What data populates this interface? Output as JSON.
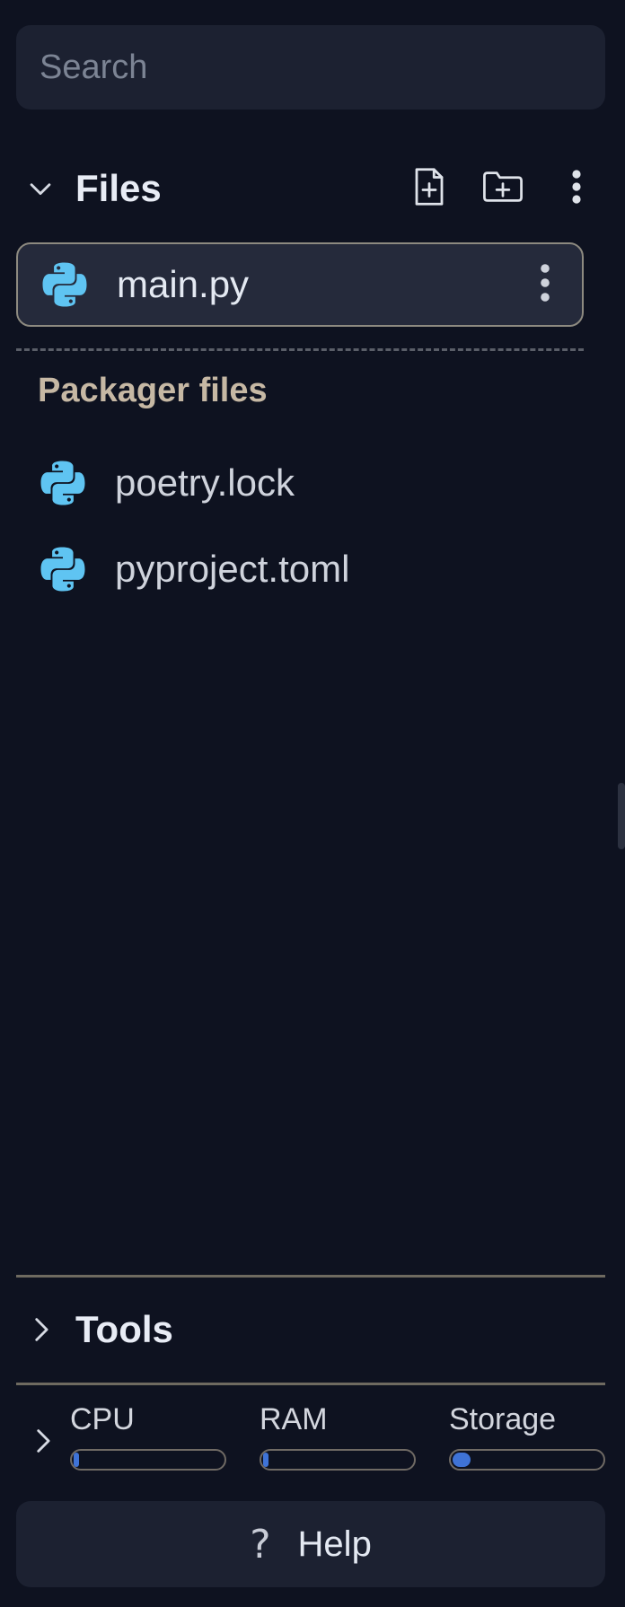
{
  "search": {
    "placeholder": "Search",
    "value": ""
  },
  "files_section": {
    "title": "Files",
    "icons": {
      "collapse": "chevron-down-icon",
      "new_file": "file-plus-icon",
      "new_folder": "folder-plus-icon",
      "more": "more-vertical-icon"
    }
  },
  "files": [
    {
      "name": "main.py",
      "icon": "python-icon",
      "selected": true
    }
  ],
  "packager": {
    "title": "Packager files",
    "items": [
      {
        "name": "poetry.lock",
        "icon": "python-icon"
      },
      {
        "name": "pyproject.toml",
        "icon": "python-icon"
      }
    ]
  },
  "tools": {
    "title": "Tools"
  },
  "resources": {
    "cpu": {
      "label": "CPU",
      "usage_percent": 2
    },
    "ram": {
      "label": "RAM",
      "usage_percent": 3
    },
    "storage": {
      "label": "Storage",
      "usage_percent": 12
    }
  },
  "help": {
    "label": "Help",
    "icon": "question-icon",
    "icon_glyph": "?"
  },
  "colors": {
    "background": "#0e1220",
    "panel": "#1c2131",
    "selected_row": "#252a3b",
    "meter_fill": "#3f73d6",
    "python_blue": "#5fc4f2",
    "section_label": "#c6b8a4"
  }
}
